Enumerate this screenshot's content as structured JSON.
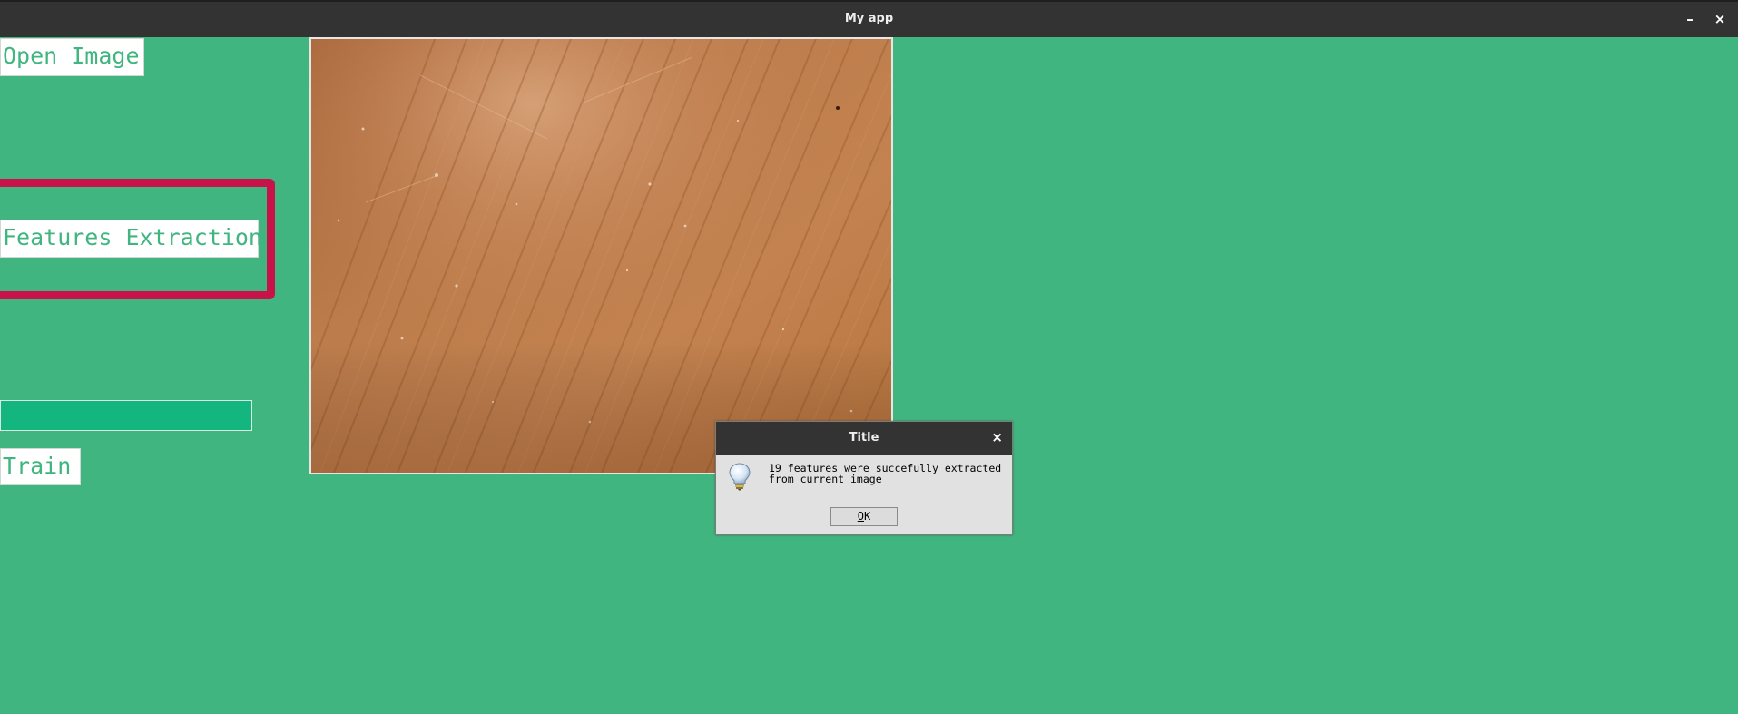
{
  "window": {
    "title": "My app",
    "minimize_glyph": "–",
    "close_glyph": "×"
  },
  "sidebar": {
    "open_image_label": "Open Image",
    "features_extraction_label": "Features Extraction",
    "train_label": "Train",
    "progress_value": 1.0
  },
  "image_panel": {
    "description_icon": "wood-texture-image"
  },
  "dialog": {
    "title": "Title",
    "close_glyph": "×",
    "message_line1": "19 features were succefully extracted",
    "message_line2": "from current image",
    "ok_mnemonic": "O",
    "ok_rest": "K",
    "icon": "lightbulb-icon"
  },
  "colors": {
    "background": "#41b57f",
    "highlight": "#c8124a",
    "progress_fill": "#12b67e",
    "titlebar": "#333333"
  }
}
